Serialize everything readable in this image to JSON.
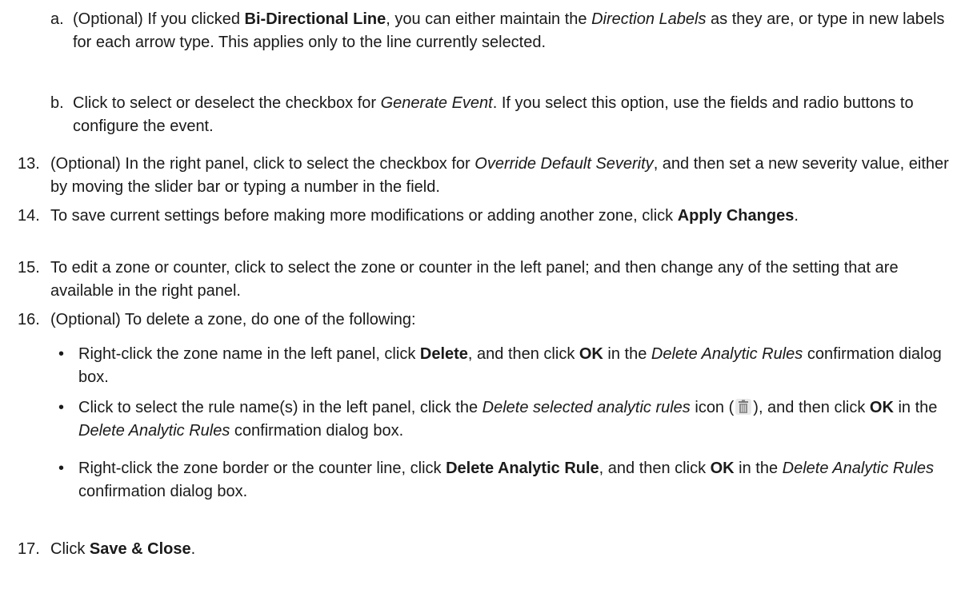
{
  "items": {
    "a": {
      "marker": "a.",
      "t1": "(Optional) If you clicked ",
      "b1": "Bi-Directional Line",
      "t2": ", you can either maintain the ",
      "i1": "Direction Labels",
      "t3": " as they are, or type in new labels for each arrow type. This applies only to the line currently selected."
    },
    "b": {
      "marker": "b.",
      "t1": "Click to select or deselect the checkbox for ",
      "i1": "Generate Event",
      "t2": ". If you select this option, use the fields and radio buttons to configure the event."
    },
    "s13": {
      "marker": "13.",
      "t1": "(Optional) In the right panel, click to select the checkbox for ",
      "i1": "Override Default Severity",
      "t2": ", and then set a new severity value, either by moving the slider bar or typing a number in the field."
    },
    "s14": {
      "marker": "14.",
      "t1": "To save current settings before making more modifications or adding another zone, click ",
      "b1": "Apply Changes",
      "t2": "."
    },
    "s15": {
      "marker": "15.",
      "t1": "To edit a zone or counter, click to select the zone or counter in the left panel; and then change any of the setting that are available in the right panel."
    },
    "s16": {
      "marker": "16.",
      "t1": "(Optional) To delete a zone, do one of the following:"
    },
    "bul1": {
      "marker": "•",
      "t1": "Right-click the zone name in the left panel, click ",
      "b1": "Delete",
      "t2": ", and then click ",
      "b2": "OK",
      "t3": " in the ",
      "i1": "Delete Analytic Rules",
      "t4": " confirmation dialog box."
    },
    "bul2": {
      "marker": "•",
      "t1": "Click to select the rule name(s) in the left panel, click the ",
      "i1": "Delete selected analytic rules",
      "t2": " icon (",
      "t3": "), and then click ",
      "b1": "OK",
      "t4": " in the ",
      "i2": "Delete Analytic Rules",
      "t5": " confirmation dialog box."
    },
    "bul3": {
      "marker": "•",
      "t1": "Right-click the zone border or the counter line, click ",
      "b1": "Delete Analytic Rule",
      "t2": ", and then click ",
      "b2": "OK",
      "t3": " in the ",
      "i1": "Delete Analytic Rules",
      "t4": " confirmation dialog box."
    },
    "s17": {
      "marker": "17.",
      "t1": "Click ",
      "b1": "Save & Close",
      "t2": "."
    }
  },
  "icons": {
    "trash": "trash-icon"
  }
}
